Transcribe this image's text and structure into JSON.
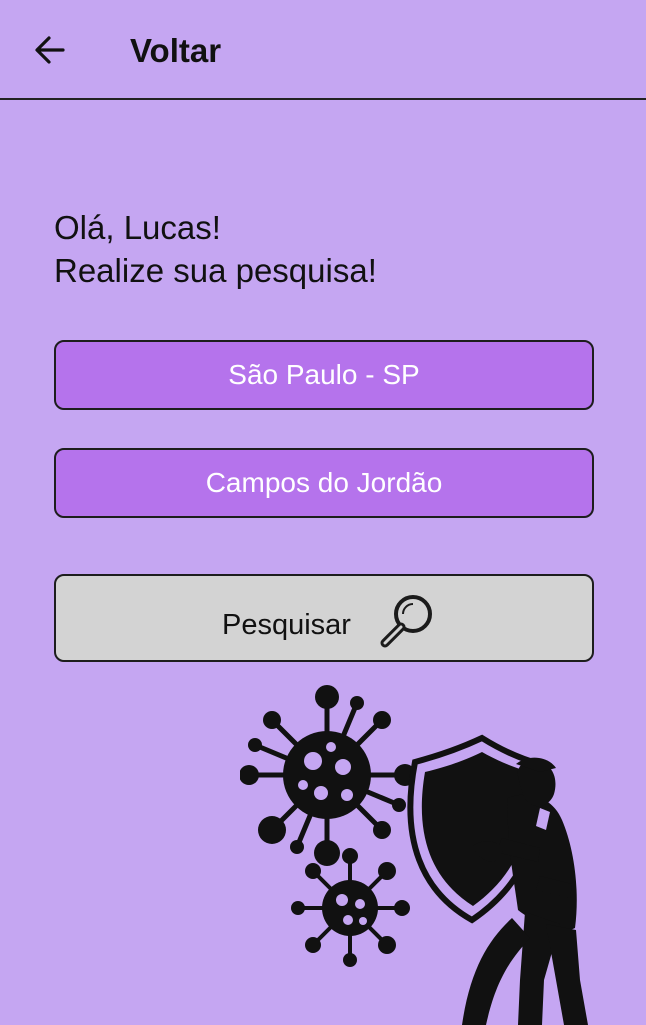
{
  "header": {
    "back_icon": "arrow-left-icon",
    "title": "Voltar"
  },
  "greeting": {
    "line1": "Olá, Lucas!",
    "line2": "Realize sua pesquisa!"
  },
  "fields": {
    "city": "São Paulo - SP",
    "destination": "Campos do Jordão"
  },
  "search": {
    "label": "Pesquisar",
    "icon": "magnifier-icon"
  },
  "illustration": {
    "icons": [
      "virus-icon",
      "virus-icon",
      "shield-icon",
      "person-icon"
    ]
  },
  "colors": {
    "background": "#c5a6f2",
    "field_fill": "#b573ec",
    "search_fill": "#d3d3d3",
    "ink": "#111111"
  }
}
